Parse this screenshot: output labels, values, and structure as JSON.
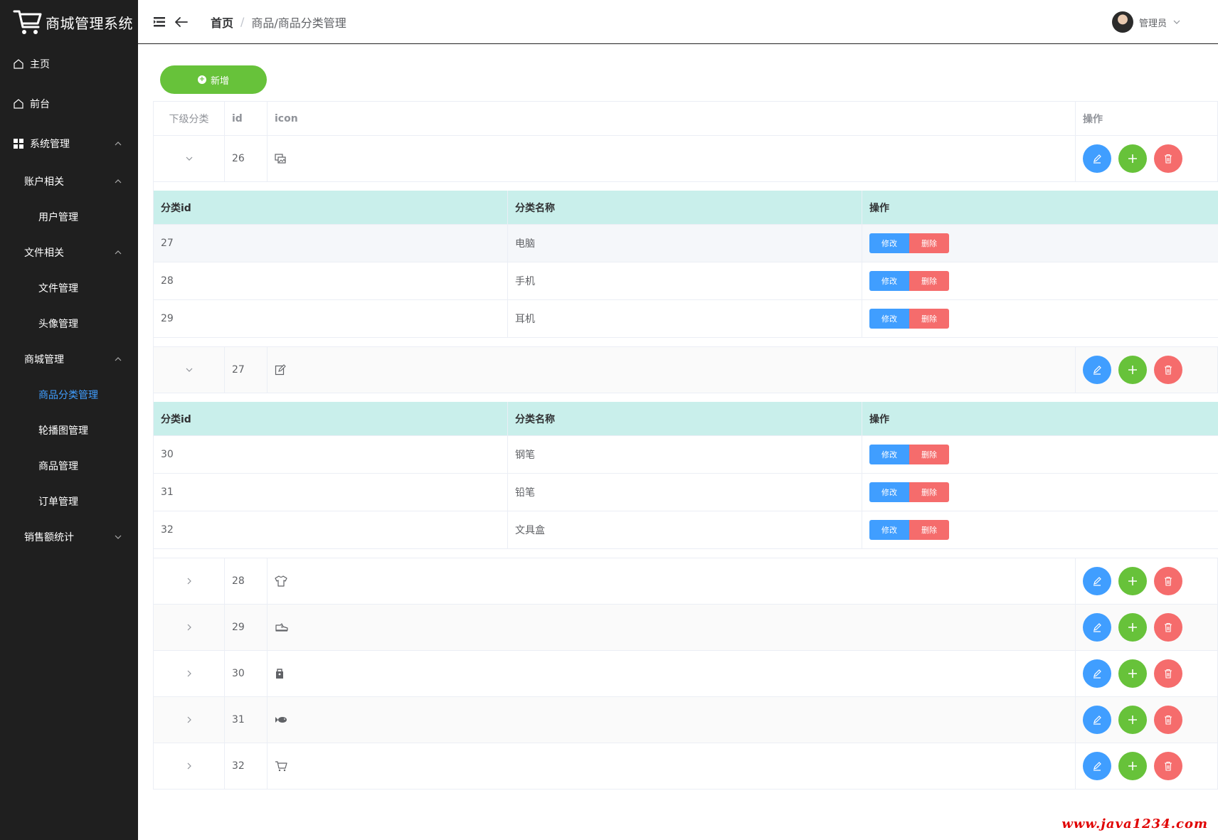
{
  "sidebar": {
    "title": "商城管理系统",
    "items": [
      {
        "label": "主页"
      },
      {
        "label": "前台"
      },
      {
        "label": "系统管理"
      },
      {
        "label": "账户相关"
      },
      {
        "label": "用户管理"
      },
      {
        "label": "文件相关"
      },
      {
        "label": "文件管理"
      },
      {
        "label": "头像管理"
      },
      {
        "label": "商城管理"
      },
      {
        "label": "商品分类管理"
      },
      {
        "label": "轮播图管理"
      },
      {
        "label": "商品管理"
      },
      {
        "label": "订单管理"
      },
      {
        "label": "销售额统计"
      }
    ]
  },
  "header": {
    "home": "首页",
    "separator": "/",
    "current": "商品/商品分类管理",
    "user": "管理员"
  },
  "toolbar": {
    "add_label": "新增"
  },
  "table": {
    "columns": {
      "expand": "下级分类",
      "id": "id",
      "icon": "icon",
      "ops": "操作"
    },
    "rows": [
      {
        "id": "26",
        "icon": "image-icon"
      },
      {
        "id": "27",
        "icon": "edit-icon"
      },
      {
        "id": "28",
        "icon": "shirt-icon"
      },
      {
        "id": "29",
        "icon": "shoe-icon"
      },
      {
        "id": "30",
        "icon": "bag-icon"
      },
      {
        "id": "31",
        "icon": "fish-icon"
      },
      {
        "id": "32",
        "icon": "cart-icon"
      }
    ]
  },
  "subtable": {
    "columns": {
      "id": "分类id",
      "name": "分类名称",
      "ops": "操作"
    },
    "edit_label": "修改",
    "delete_label": "删除",
    "groups": [
      [
        {
          "id": "27",
          "name": "电脑"
        },
        {
          "id": "28",
          "name": "手机"
        },
        {
          "id": "29",
          "name": "耳机"
        }
      ],
      [
        {
          "id": "30",
          "name": "钢笔"
        },
        {
          "id": "31",
          "name": "铅笔"
        },
        {
          "id": "32",
          "name": "文具盒"
        }
      ]
    ]
  },
  "watermark": "www.java1234.com",
  "colors": {
    "primary": "#409eff",
    "success": "#67c23a",
    "danger": "#f56c6c",
    "sidebar_bg": "#1f1f1f",
    "subhead_bg": "#c9efeb"
  }
}
